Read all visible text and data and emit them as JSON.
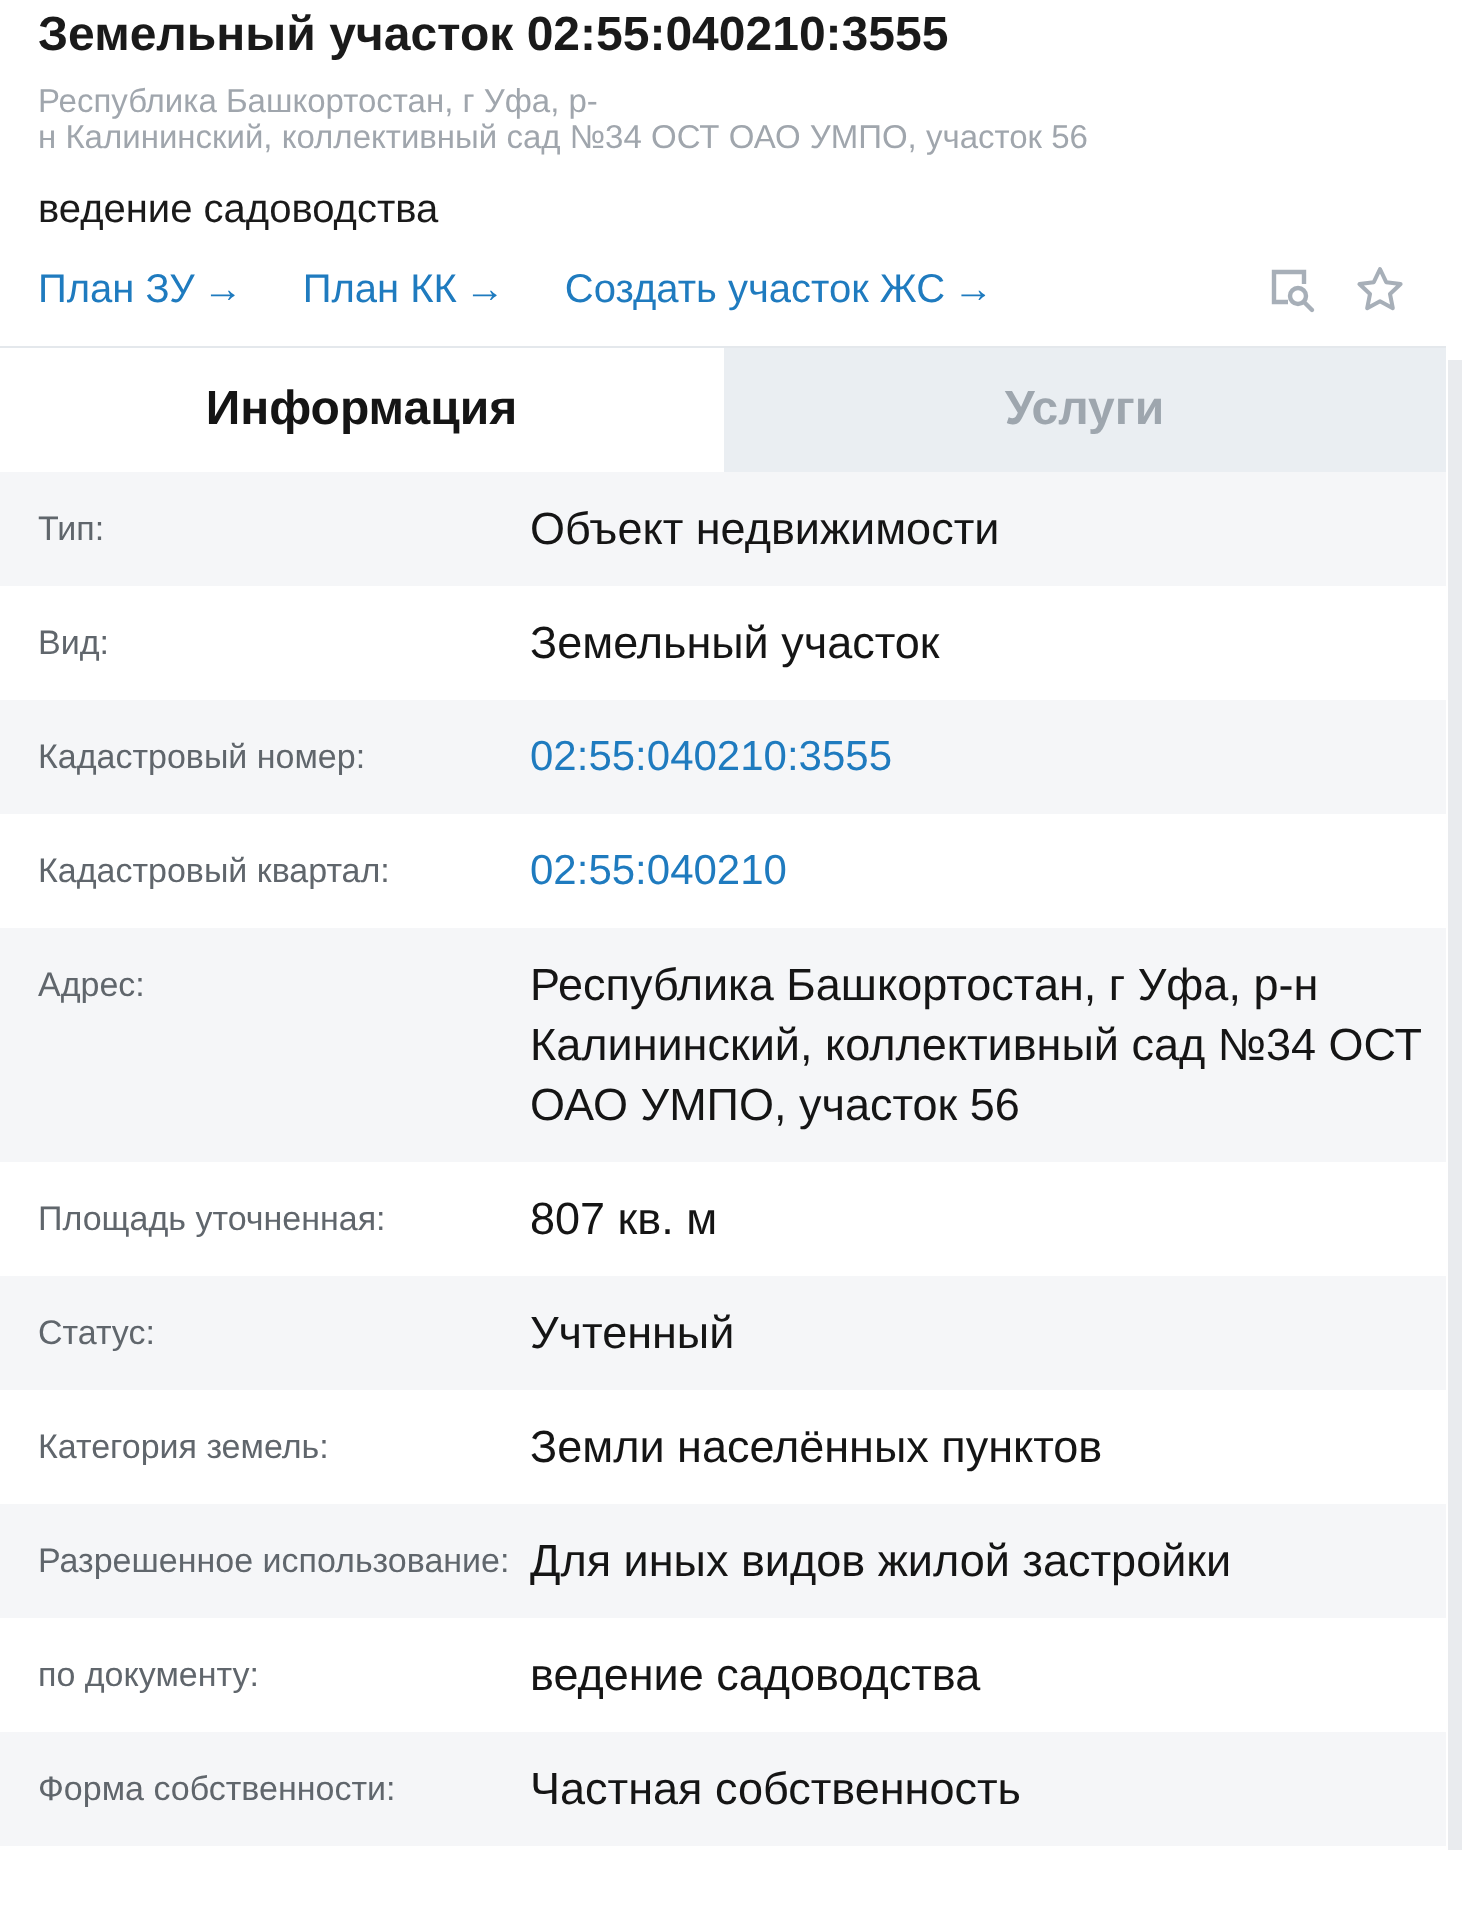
{
  "header": {
    "title": "Земельный участок 02:55:040210:3555",
    "address_lines": [
      "Республика Башкортостан, г Уфа, р-",
      "н Калининский, коллективный сад №34 ОСТ ОАО УМПО, участок 56"
    ],
    "purpose": "ведение садоводства"
  },
  "links": [
    {
      "label": "План ЗУ",
      "arrow": "→"
    },
    {
      "label": "План КК",
      "arrow": "→"
    },
    {
      "label": "Создать участок ЖС",
      "arrow": "→"
    }
  ],
  "tabs": [
    {
      "label": "Информация",
      "selected": true
    },
    {
      "label": "Услуги",
      "selected": false
    }
  ],
  "rows": [
    {
      "label": "Тип:",
      "value": "Объект недвижимости",
      "kind": "text"
    },
    {
      "label": "Вид:",
      "value": "Земельный участок",
      "kind": "text"
    },
    {
      "label": "Кадастровый номер:",
      "value": "02:55:040210:3555",
      "kind": "link"
    },
    {
      "label": "Кадастровый квартал:",
      "value": "02:55:040210",
      "kind": "link"
    },
    {
      "label": "Адрес:",
      "value": "Республика Башкортостан, г Уфа, р-н Калининский, коллективный сад №34 ОСТ ОАО УМПО, участок 56",
      "kind": "text"
    },
    {
      "label": "Площадь уточненная:",
      "value": "807 кв. м",
      "kind": "text"
    },
    {
      "label": "Статус:",
      "value": "Учтенный",
      "kind": "text"
    },
    {
      "label": "Категория земель:",
      "value": "Земли населённых пунктов",
      "kind": "text"
    },
    {
      "label": "Разрешенное использование:",
      "value": "Для иных видов жилой застройки",
      "kind": "text"
    },
    {
      "label": "по документу:",
      "value": "ведение садоводства",
      "kind": "text"
    },
    {
      "label": "Форма собственности:",
      "value": "Частная собственность",
      "kind": "text"
    }
  ]
}
